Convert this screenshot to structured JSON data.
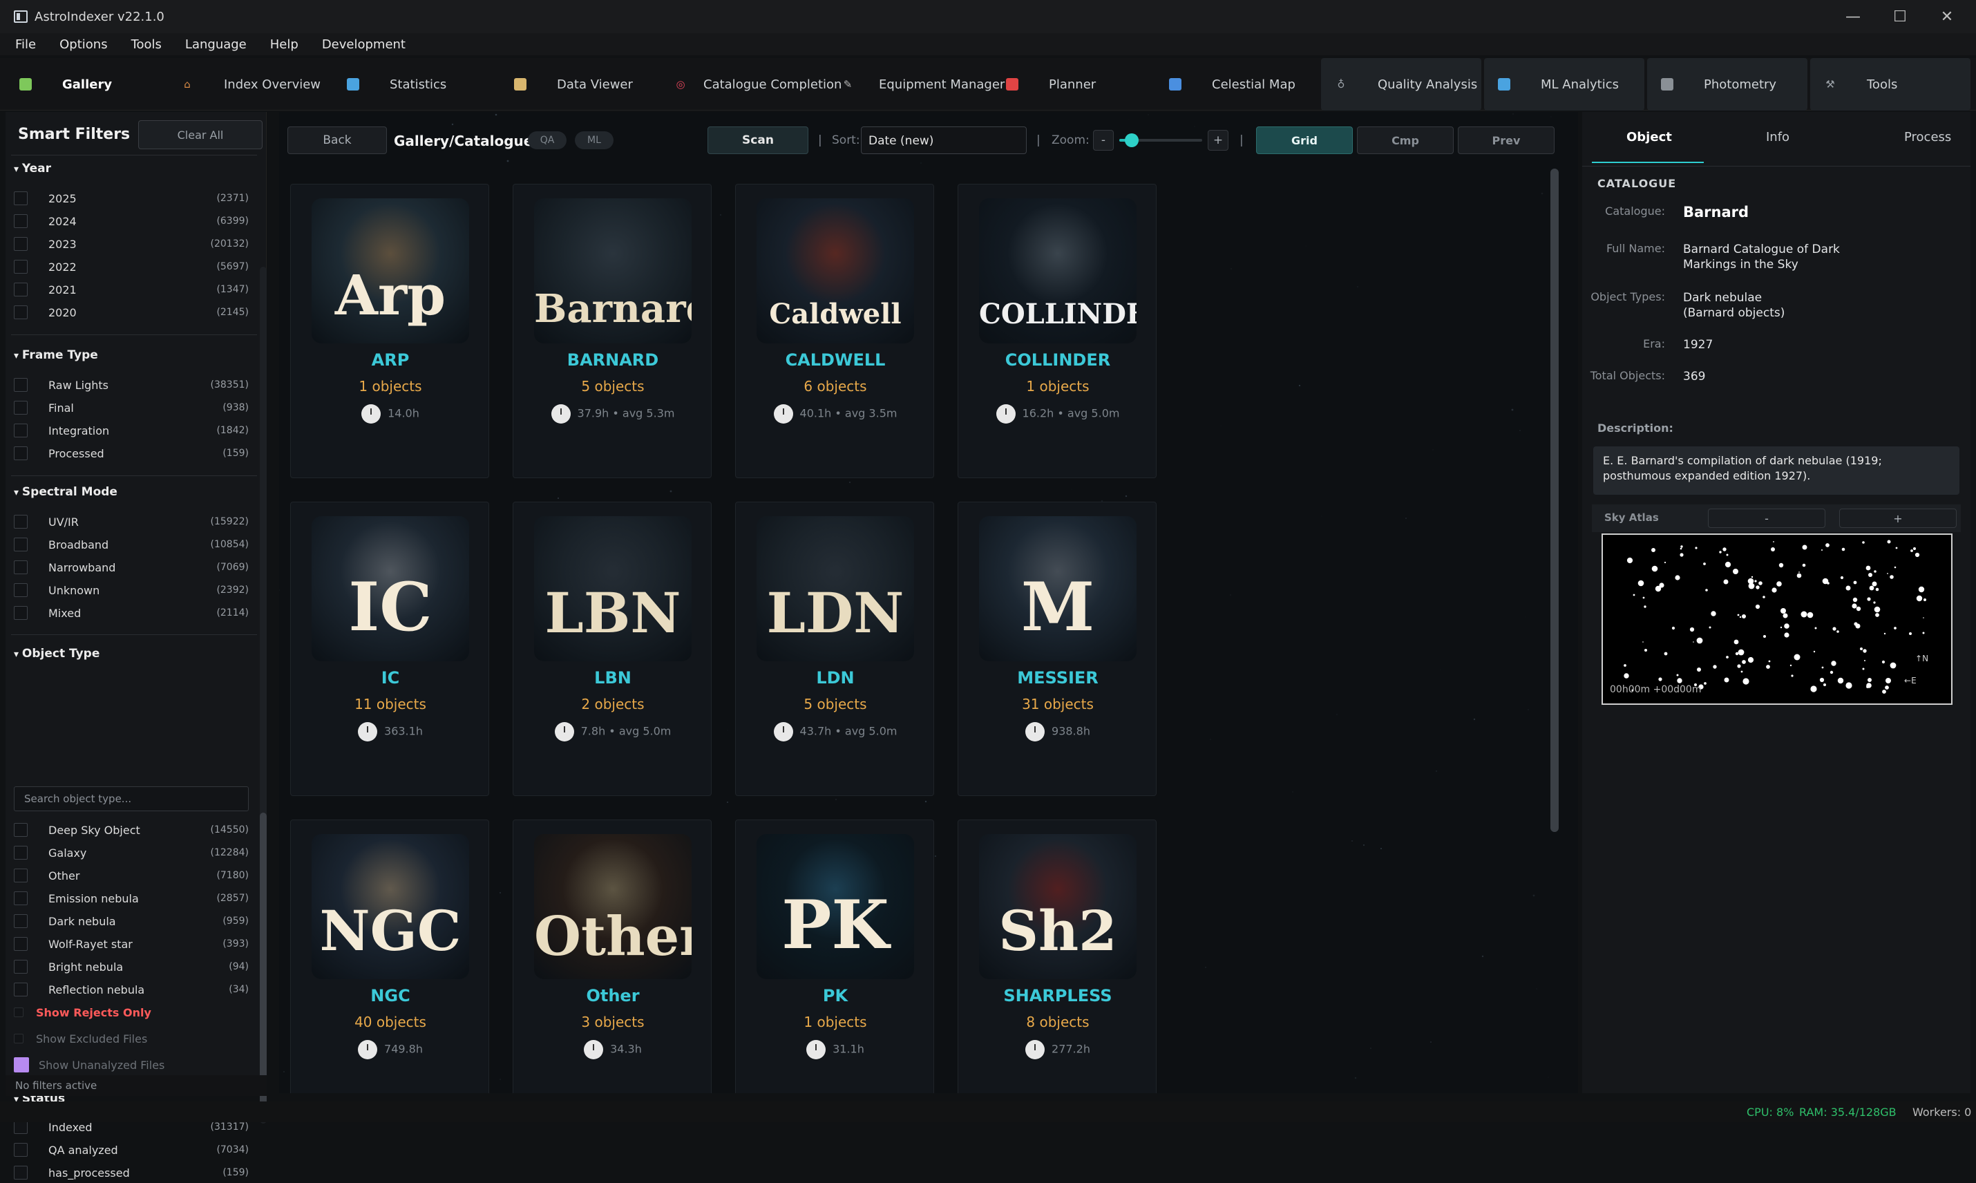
{
  "window": {
    "title": "AstroIndexer v22.1.0",
    "min": "—",
    "max": "☐",
    "close": "✕"
  },
  "menu": [
    "File",
    "Options",
    "Tools",
    "Language",
    "Help",
    "Development"
  ],
  "tabs": [
    {
      "label": "Gallery",
      "icon": "gallery-icon",
      "color": "#7ec85b"
    },
    {
      "label": "Index  Overview",
      "icon": "home-icon",
      "color": "#d98b46"
    },
    {
      "label": "Statistics",
      "icon": "bar-chart-icon",
      "color": "#4aa3e0"
    },
    {
      "label": "Data Viewer",
      "icon": "clipboard-icon",
      "color": "#d8b66e"
    },
    {
      "label": "Catalogue Completion",
      "icon": "target-icon",
      "color": "#e0455a"
    },
    {
      "label": "Equipment Manager",
      "icon": "wrench-icon",
      "color": "#b7b7b7"
    },
    {
      "label": "Planner",
      "icon": "calendar-icon",
      "color": "#e04444"
    },
    {
      "label": "Celestial Map",
      "icon": "map-icon",
      "color": "#4a8fe0"
    },
    {
      "label": "Quality Analysis",
      "icon": "microscope-icon",
      "color": "#9aa0a6"
    },
    {
      "label": "ML Analytics",
      "icon": "line-chart-icon",
      "color": "#4aa3e0"
    },
    {
      "label": "Photometry",
      "icon": "telescope-icon",
      "color": "#9aa0a6"
    },
    {
      "label": "Tools",
      "icon": "hammer-icon",
      "color": "#9aa0a6"
    }
  ],
  "filters": {
    "title": "Smart Filters",
    "clear": "Clear All",
    "year": {
      "title": "Year",
      "items": [
        {
          "label": "2025",
          "count": "(2371)"
        },
        {
          "label": "2024",
          "count": "(6399)"
        },
        {
          "label": "2023",
          "count": "(20132)"
        },
        {
          "label": "2022",
          "count": "(5697)"
        },
        {
          "label": "2021",
          "count": "(1347)"
        },
        {
          "label": "2020",
          "count": "(2145)"
        }
      ]
    },
    "frame": {
      "title": "Frame Type",
      "items": [
        {
          "label": "Raw Lights",
          "count": "(38351)"
        },
        {
          "label": "Final",
          "count": "(938)"
        },
        {
          "label": "Integration",
          "count": "(1842)"
        },
        {
          "label": "Processed",
          "count": "(159)"
        }
      ]
    },
    "spectral": {
      "title": "Spectral Mode",
      "items": [
        {
          "label": "UV/IR",
          "count": "(15922)"
        },
        {
          "label": "Broadband",
          "count": "(10854)"
        },
        {
          "label": "Narrowband",
          "count": "(7069)"
        },
        {
          "label": "Unknown",
          "count": "(2392)"
        },
        {
          "label": "Mixed",
          "count": "(2114)"
        }
      ]
    },
    "objtype": {
      "title": "Object Type",
      "search": "Search object type...",
      "items": [
        {
          "label": "Deep Sky Object",
          "count": "(14550)"
        },
        {
          "label": "Galaxy",
          "count": "(12284)"
        },
        {
          "label": "Other",
          "count": "(7180)"
        },
        {
          "label": "Emission nebula",
          "count": "(2857)"
        },
        {
          "label": "Dark nebula",
          "count": "(959)"
        },
        {
          "label": "Wolf-Rayet star",
          "count": "(393)"
        },
        {
          "label": "Bright nebula",
          "count": "(94)"
        },
        {
          "label": "Reflection nebula",
          "count": "(34)"
        }
      ]
    },
    "show_rejects": "Show Rejects Only",
    "show_excluded": "Show Excluded Files",
    "show_unanalyzed": "Show Unanalyzed Files",
    "status": {
      "title": "Status",
      "items": [
        {
          "label": "Indexed",
          "count": "(31317)"
        },
        {
          "label": "QA analyzed",
          "count": "(7034)"
        },
        {
          "label": "has_processed",
          "count": "(159)"
        }
      ]
    },
    "footer": "No filters active"
  },
  "toolbar": {
    "back": "Back",
    "path": "Gallery/Catalogues",
    "qa": "QA",
    "ml": "ML",
    "scan": "Scan",
    "sort_label": "Sort:",
    "sort_value": "Date (new)",
    "zoom_label": "Zoom:",
    "zoom_minus": "-",
    "zoom_plus": "+",
    "zoom_level": 0.15,
    "grid": "Grid",
    "cmp": "Cmp",
    "prev": "Prev",
    "divider": "|"
  },
  "cards": [
    {
      "logo": "Arp",
      "name": "ARP",
      "objects": "1 objects",
      "hours": "14.0h"
    },
    {
      "logo": "Barnard",
      "name": "BARNARD",
      "objects": "5 objects",
      "hours": "37.9h • avg 5.3m"
    },
    {
      "logo": "Caldwell",
      "name": "CALDWELL",
      "objects": "6 objects",
      "hours": "40.1h • avg 3.5m"
    },
    {
      "logo": "COLLINDER",
      "name": "COLLINDER",
      "objects": "1 objects",
      "hours": "16.2h • avg 5.0m"
    },
    {
      "logo": "IC",
      "name": "IC",
      "objects": "11 objects",
      "hours": "363.1h"
    },
    {
      "logo": "LBN",
      "name": "LBN",
      "objects": "2 objects",
      "hours": "7.8h • avg 5.0m"
    },
    {
      "logo": "LDN",
      "name": "LDN",
      "objects": "5 objects",
      "hours": "43.7h • avg 5.0m"
    },
    {
      "logo": "M",
      "name": "MESSIER",
      "objects": "31 objects",
      "hours": "938.8h"
    },
    {
      "logo": "NGC",
      "name": "NGC",
      "objects": "40 objects",
      "hours": "749.8h"
    },
    {
      "logo": "Other",
      "name": "Other",
      "objects": "3 objects",
      "hours": "34.3h"
    },
    {
      "logo": "PK",
      "name": "PK",
      "objects": "1 objects",
      "hours": "31.1h"
    },
    {
      "logo": "Sh2",
      "name": "SHARPLESS",
      "objects": "8 objects",
      "hours": "277.2h"
    }
  ],
  "detail": {
    "tabs": [
      "Object",
      "Info",
      "Process"
    ],
    "section": "CATALOGUE",
    "fields": [
      {
        "label": "Catalogue:",
        "value": "Barnard"
      },
      {
        "label": "Full Name:",
        "value": "Barnard Catalogue of Dark Markings in the Sky"
      },
      {
        "label": "Object Types:",
        "value": "Dark nebulae (Barnard objects)"
      },
      {
        "label": "Era:",
        "value": "1927"
      },
      {
        "label": "Total Objects:",
        "value": "369"
      }
    ],
    "desc_title": "Description:",
    "description": "E. E. Barnard's compilation of dark nebulae (1919; posthumous expanded edition 1927).",
    "atlas_title": "Sky Atlas",
    "atlas_minus": "-",
    "atlas_plus": "+",
    "atlas_coord": "00h00m +00d00m",
    "compass_n": "N",
    "compass_e": "E"
  },
  "status": {
    "cpu": "CPU: 8%",
    "ram": "RAM: 35.4/128GB",
    "workers": "Workers: 0"
  }
}
